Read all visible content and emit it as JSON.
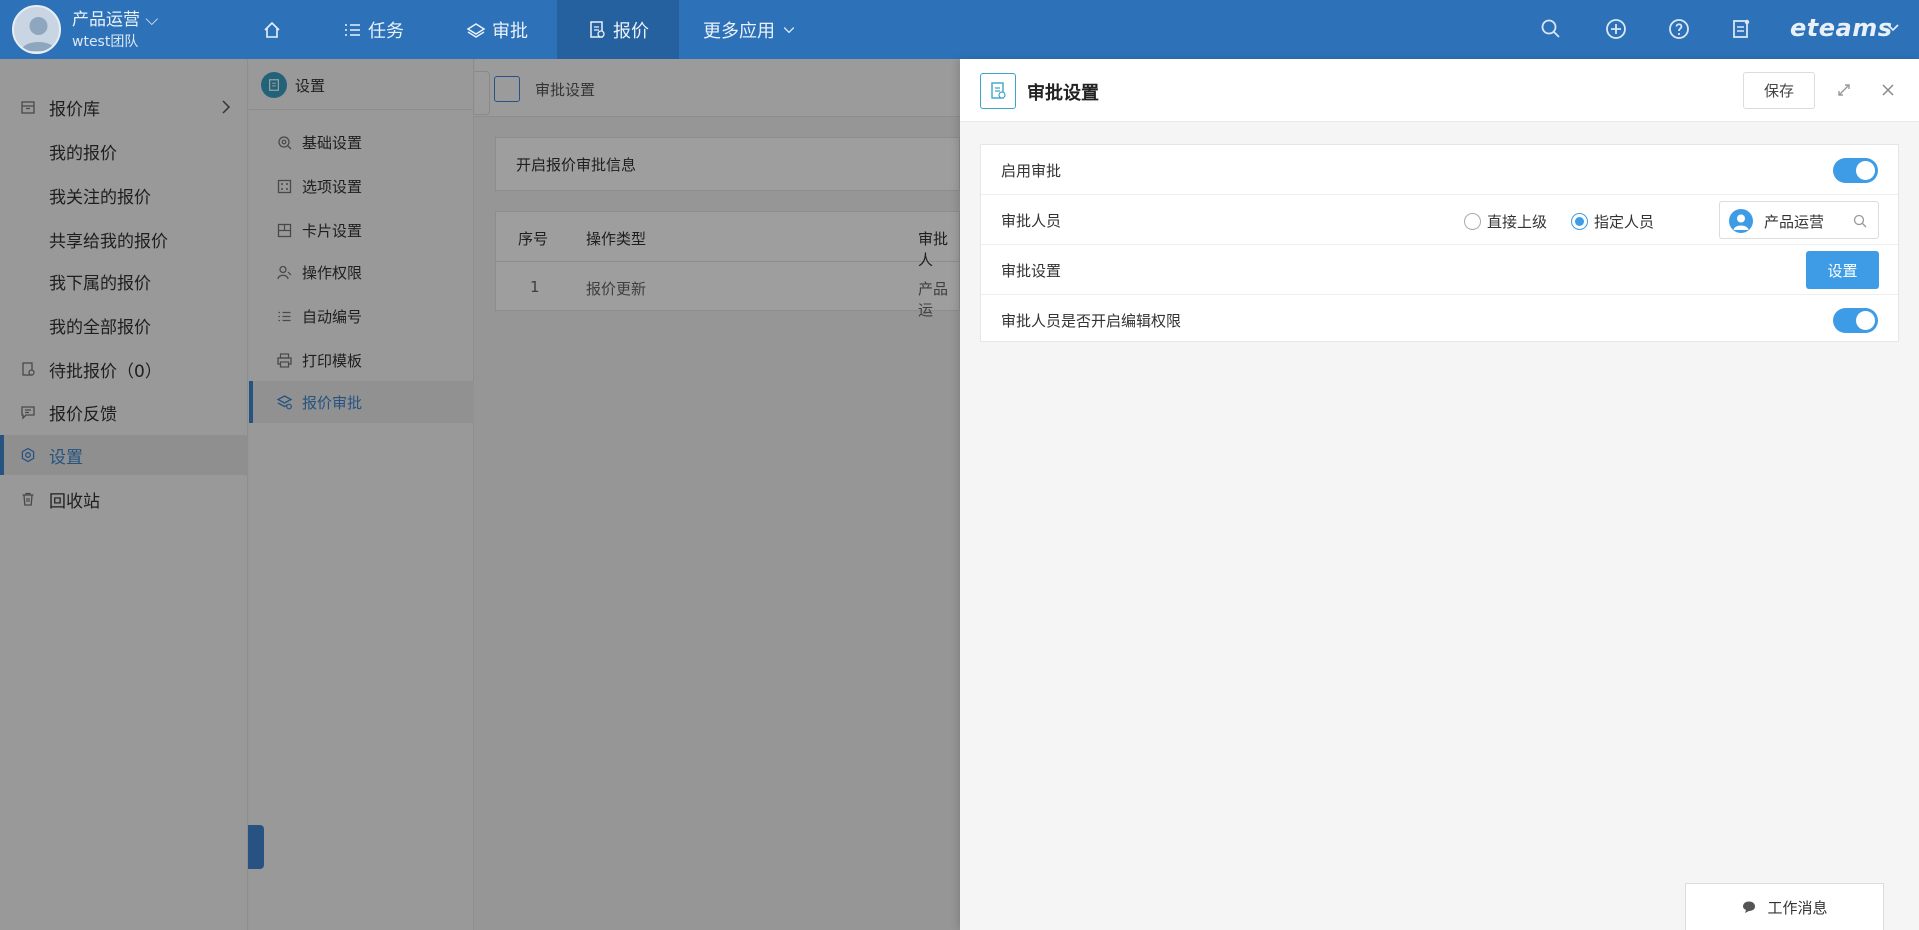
{
  "topbar": {
    "user_name": "产品运营",
    "user_team": "wtest团队",
    "nav": [
      {
        "label": ""
      },
      {
        "label": "任务"
      },
      {
        "label": "审批"
      },
      {
        "label": "报价"
      },
      {
        "label": "更多应用"
      }
    ],
    "brand": "eteams",
    "accent": "#2d72b8"
  },
  "sidebar": {
    "items": [
      {
        "label": "报价库"
      },
      {
        "label": "我的报价"
      },
      {
        "label": "我关注的报价"
      },
      {
        "label": "共享给我的报价"
      },
      {
        "label": "我下属的报价"
      },
      {
        "label": "我的全部报价"
      },
      {
        "label": "待批报价（0）"
      },
      {
        "label": "报价反馈"
      },
      {
        "label": "设置"
      },
      {
        "label": "回收站"
      }
    ]
  },
  "submenu": {
    "title": "设置",
    "items": [
      {
        "label": "基础设置"
      },
      {
        "label": "选项设置"
      },
      {
        "label": "卡片设置"
      },
      {
        "label": "操作权限"
      },
      {
        "label": "自动编号"
      },
      {
        "label": "打印模板"
      },
      {
        "label": "报价审批"
      }
    ]
  },
  "main": {
    "breadcrumb": "审批设置",
    "info": "开启报价审批信息",
    "table": {
      "headers": [
        "序号",
        "操作类型",
        "审批人"
      ],
      "rows": [
        [
          "1",
          "报价更新",
          "产品运"
        ]
      ]
    }
  },
  "drawer": {
    "title": "审批设置",
    "save_label": "保存",
    "rows": {
      "enable_label": "启用审批",
      "approver_label": "审批人员",
      "radio_direct": "直接上级",
      "radio_specified": "指定人员",
      "person_name": "产品运营",
      "settings_label": "审批设置",
      "settings_button": "设置",
      "edit_label": "审批人员是否开启编辑权限"
    }
  },
  "footer": {
    "message_label": "工作消息"
  }
}
